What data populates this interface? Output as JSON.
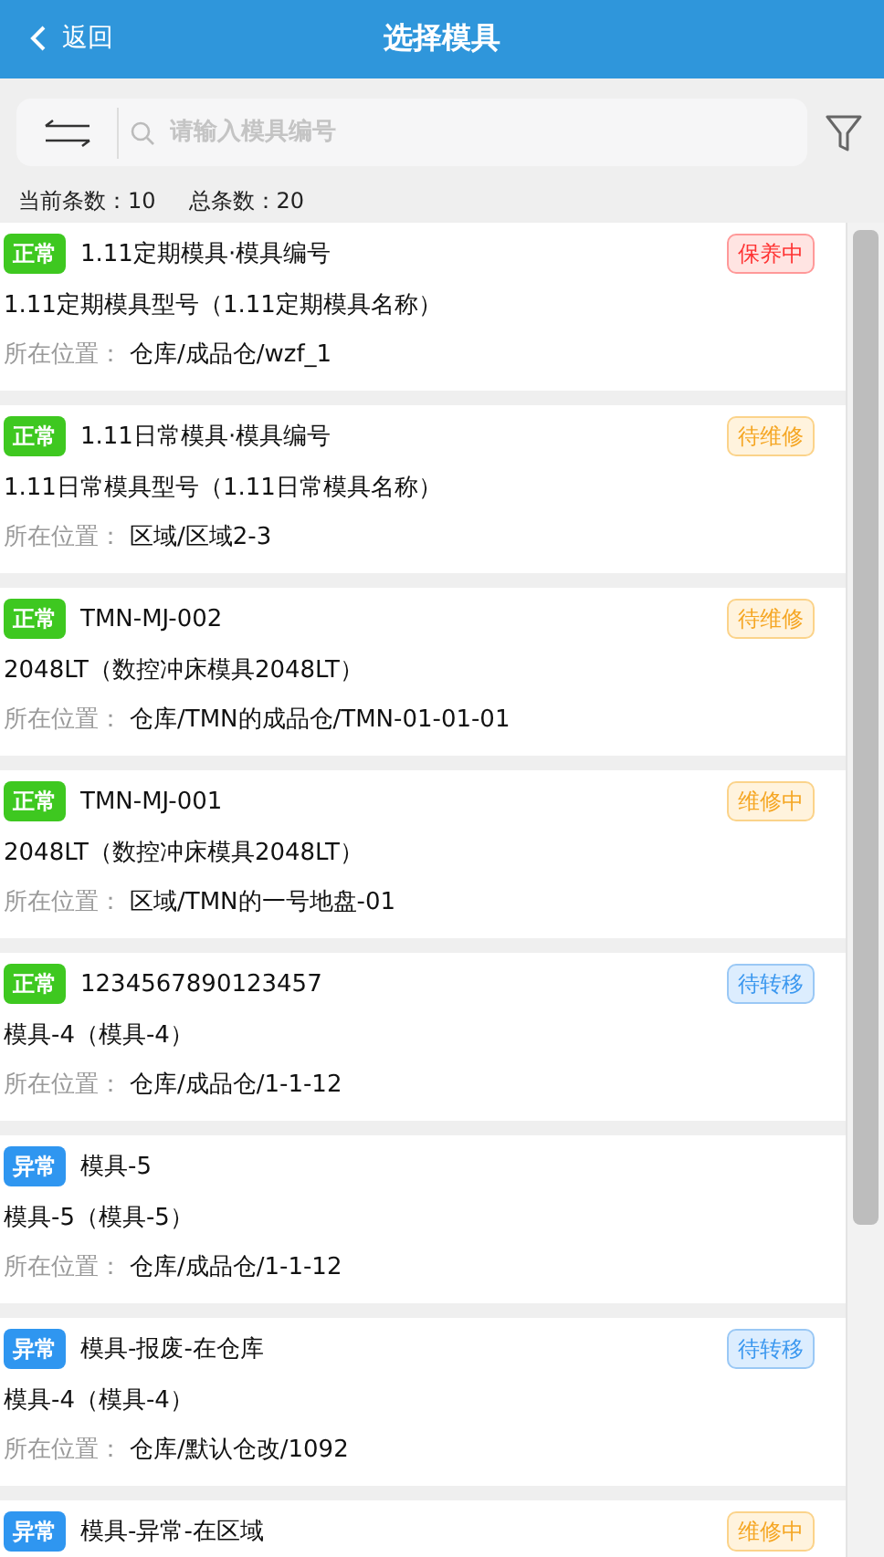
{
  "header": {
    "back": "返回",
    "title": "选择模具"
  },
  "search": {
    "placeholder": "请输入模具编号"
  },
  "counts": {
    "current_label": "当前条数：",
    "current": "10",
    "total_label": "总条数：",
    "total": "20"
  },
  "molds": [
    {
      "health": {
        "kind": "normal",
        "text": "正常"
      },
      "code": "1.11定期模具·模具编号",
      "status": {
        "kind": "maintenance",
        "text": "保养中"
      },
      "model": "1.11定期模具型号（1.11定期模具名称）",
      "location_label": "所在位置：",
      "location": "仓库/成品仓/wzf_1"
    },
    {
      "health": {
        "kind": "normal",
        "text": "正常"
      },
      "code": "1.11日常模具·模具编号",
      "status": {
        "kind": "repair",
        "text": "待维修"
      },
      "model": "1.11日常模具型号（1.11日常模具名称）",
      "location_label": "所在位置：",
      "location": "区域/区域2-3"
    },
    {
      "health": {
        "kind": "normal",
        "text": "正常"
      },
      "code": "TMN-MJ-002",
      "status": {
        "kind": "repair",
        "text": "待维修"
      },
      "model": "2048LT（数控冲床模具2048LT）",
      "location_label": "所在位置：",
      "location": "仓库/TMN的成品仓/TMN-01-01-01"
    },
    {
      "health": {
        "kind": "normal",
        "text": "正常"
      },
      "code": "TMN-MJ-001",
      "status": {
        "kind": "repair",
        "text": "维修中"
      },
      "model": "2048LT（数控冲床模具2048LT）",
      "location_label": "所在位置：",
      "location": "区域/TMN的一号地盘-01"
    },
    {
      "health": {
        "kind": "normal",
        "text": "正常"
      },
      "code": "1234567890123457",
      "status": {
        "kind": "transfer",
        "text": "待转移"
      },
      "model": "模具-4（模具-4）",
      "location_label": "所在位置：",
      "location": "仓库/成品仓/1-1-12"
    },
    {
      "health": {
        "kind": "abnormal",
        "text": "异常"
      },
      "code": "模具-5",
      "model": "模具-5（模具-5）",
      "location_label": "所在位置：",
      "location": "仓库/成品仓/1-1-12"
    },
    {
      "health": {
        "kind": "abnormal",
        "text": "异常"
      },
      "code": "模具-报废-在仓库",
      "status": {
        "kind": "transfer",
        "text": "待转移"
      },
      "model": "模具-4（模具-4）",
      "location_label": "所在位置：",
      "location": "仓库/默认仓改/1092"
    },
    {
      "health": {
        "kind": "abnormal",
        "text": "异常"
      },
      "code": "模具-异常-在区域",
      "status": {
        "kind": "repair",
        "text": "维修中"
      }
    }
  ]
}
